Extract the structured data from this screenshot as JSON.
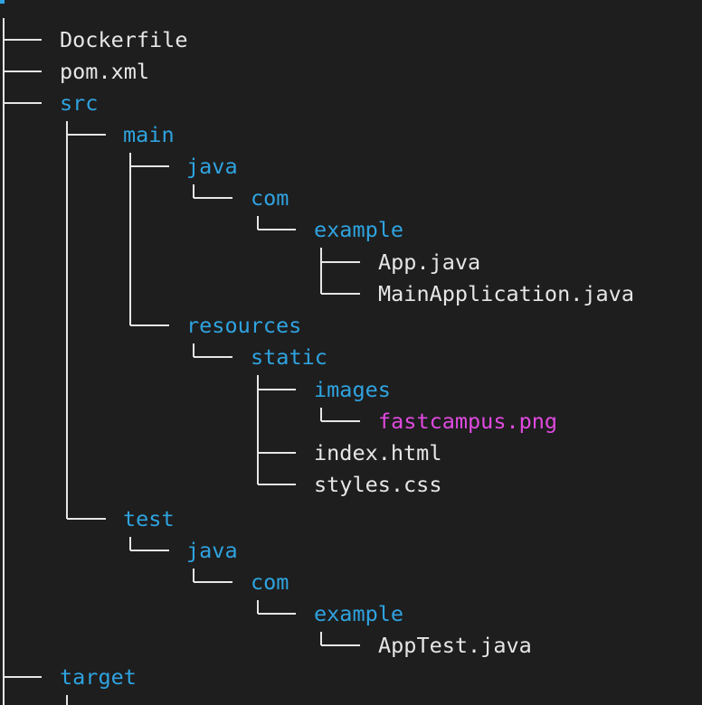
{
  "colors": {
    "background": "#1e1e1e",
    "file": "#e6e6e6",
    "directory": "#2fa3e0",
    "image_file": "#e04ae0",
    "tree_lines": "#e6e6e6"
  },
  "tree": [
    {
      "name": "Dockerfile",
      "type": "file"
    },
    {
      "name": "pom.xml",
      "type": "file"
    },
    {
      "name": "src",
      "type": "directory"
    },
    {
      "name": "main",
      "type": "directory"
    },
    {
      "name": "java",
      "type": "directory"
    },
    {
      "name": "com",
      "type": "directory"
    },
    {
      "name": "example",
      "type": "directory"
    },
    {
      "name": "App.java",
      "type": "file"
    },
    {
      "name": "MainApplication.java",
      "type": "file"
    },
    {
      "name": "resources",
      "type": "directory"
    },
    {
      "name": "static",
      "type": "directory"
    },
    {
      "name": "images",
      "type": "directory"
    },
    {
      "name": "fastcampus.png",
      "type": "image"
    },
    {
      "name": "index.html",
      "type": "file"
    },
    {
      "name": "styles.css",
      "type": "file"
    },
    {
      "name": "test",
      "type": "directory"
    },
    {
      "name": "java",
      "type": "directory"
    },
    {
      "name": "com",
      "type": "directory"
    },
    {
      "name": "example",
      "type": "directory"
    },
    {
      "name": "AppTest.java",
      "type": "file"
    },
    {
      "name": "target",
      "type": "directory"
    }
  ]
}
